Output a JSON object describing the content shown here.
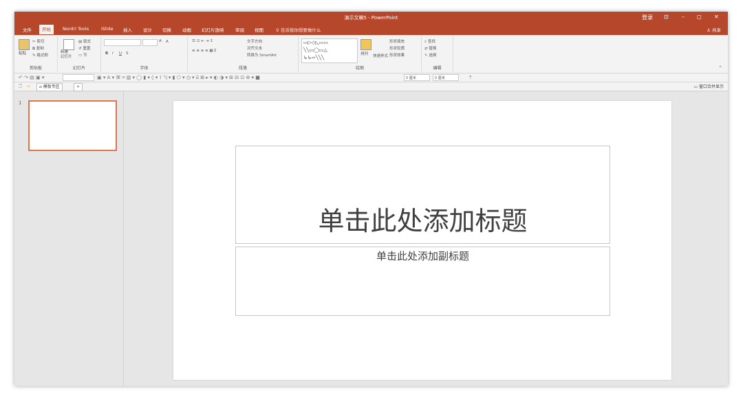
{
  "window": {
    "title": "演示文稿5 - PowerPoint",
    "login": "登录",
    "restore_icon": "ribbon-display-icon",
    "minimize": "–",
    "maximize": "◻",
    "close": "✕"
  },
  "tabs": [
    {
      "label": "文件"
    },
    {
      "label": "开始"
    },
    {
      "label": "Nordri Tools"
    },
    {
      "label": "iSlide"
    },
    {
      "label": "插入"
    },
    {
      "label": "设计"
    },
    {
      "label": "切换"
    },
    {
      "label": "动画"
    },
    {
      "label": "幻灯片放映"
    },
    {
      "label": "审阅"
    },
    {
      "label": "视图"
    }
  ],
  "tellme": "告诉我你想要做什么",
  "share": "共享",
  "ribbon": {
    "clipboard": {
      "paste": "粘贴",
      "cut": "剪切",
      "copy": "复制",
      "format_painter": "格式刷",
      "label": "剪贴板"
    },
    "slides": {
      "new_slide": "新建\n幻灯片",
      "layout": "版式",
      "reset": "重置",
      "section": "节",
      "label": "幻灯片"
    },
    "font": {
      "bold": "B",
      "italic": "I",
      "underline": "U",
      "strike": "S",
      "grow": "A",
      "shrink": "A",
      "label": "字体"
    },
    "paragraph": {
      "text_direction": "文字方向",
      "align_text": "对齐文本",
      "convert_smartart": "转换为 SmartArt",
      "label": "段落"
    },
    "drawing": {
      "arrange": "排列",
      "quick_styles": "快速样式",
      "shape_fill": "形状填充",
      "shape_outline": "形状轮廓",
      "shape_effects": "形状效果",
      "label": "绘图"
    },
    "editing": {
      "find": "查找",
      "replace": "替换",
      "select": "选择",
      "label": "编辑"
    }
  },
  "qat": {
    "width_value": "0 厘米",
    "height_value": "0 厘米"
  },
  "filetabs": {
    "template_tab": "模板专区",
    "add": "+",
    "split_window": "窗口合并显示"
  },
  "thumbs": [
    {
      "number": "1"
    }
  ],
  "slide": {
    "title_placeholder": "单击此处添加标题",
    "subtitle_placeholder": "单击此处添加副标题"
  },
  "colors": {
    "accent": "#b7472a",
    "thumb_border": "#e2734f"
  }
}
